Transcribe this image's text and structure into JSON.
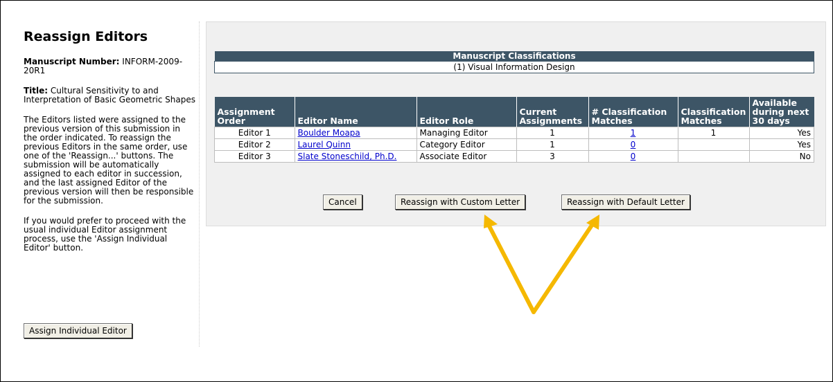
{
  "left": {
    "heading": "Reassign Editors",
    "manuscript_label": "Manuscript Number:",
    "manuscript_value": "INFORM-2009-20R1",
    "title_label": "Title:",
    "title_value": "Cultural Sensitivity to and Interpretation of Basic Geometric Shapes",
    "para1": "The Editors listed were assigned to the previous version of this submission in the order indicated. To reassign the previous Editors in the same order, use one of the 'Reassign...' buttons. The submission will be automatically assigned to each editor in succession, and the last assigned Editor of the previous version will then be responsible for the submission.",
    "para2": "If you would prefer to proceed with the usual individual Editor assignment process, use the 'Assign Individual Editor' button.",
    "assign_button": "Assign Individual Editor"
  },
  "classifications": {
    "header": "Manuscript Classifications",
    "value": "(1) Visual Information Design"
  },
  "editors": {
    "columns": [
      "Assignment Order",
      "Editor Name",
      "Editor Role",
      "Current Assignments",
      "# Classification Matches",
      "Classification Matches",
      "Available during next 30 days"
    ],
    "rows": [
      {
        "order": "Editor 1",
        "name": "Boulder Moapa",
        "role": "Managing Editor",
        "current": "1",
        "num_matches": "1",
        "matches": "1",
        "available": "Yes"
      },
      {
        "order": "Editor 2",
        "name": "Laurel Quinn",
        "role": "Category Editor",
        "current": "1",
        "num_matches": "0",
        "matches": "",
        "available": "Yes"
      },
      {
        "order": "Editor 3",
        "name": "Slate Stoneschild, Ph.D.",
        "role": "Associate Editor",
        "current": "3",
        "num_matches": "0",
        "matches": "",
        "available": "No"
      }
    ]
  },
  "buttons": {
    "cancel": "Cancel",
    "custom": "Reassign with Custom Letter",
    "default": "Reassign with Default Letter"
  },
  "colors": {
    "table_header": "#3d5566",
    "panel_bg": "#f0f0f0",
    "arrow": "#f5b800"
  }
}
